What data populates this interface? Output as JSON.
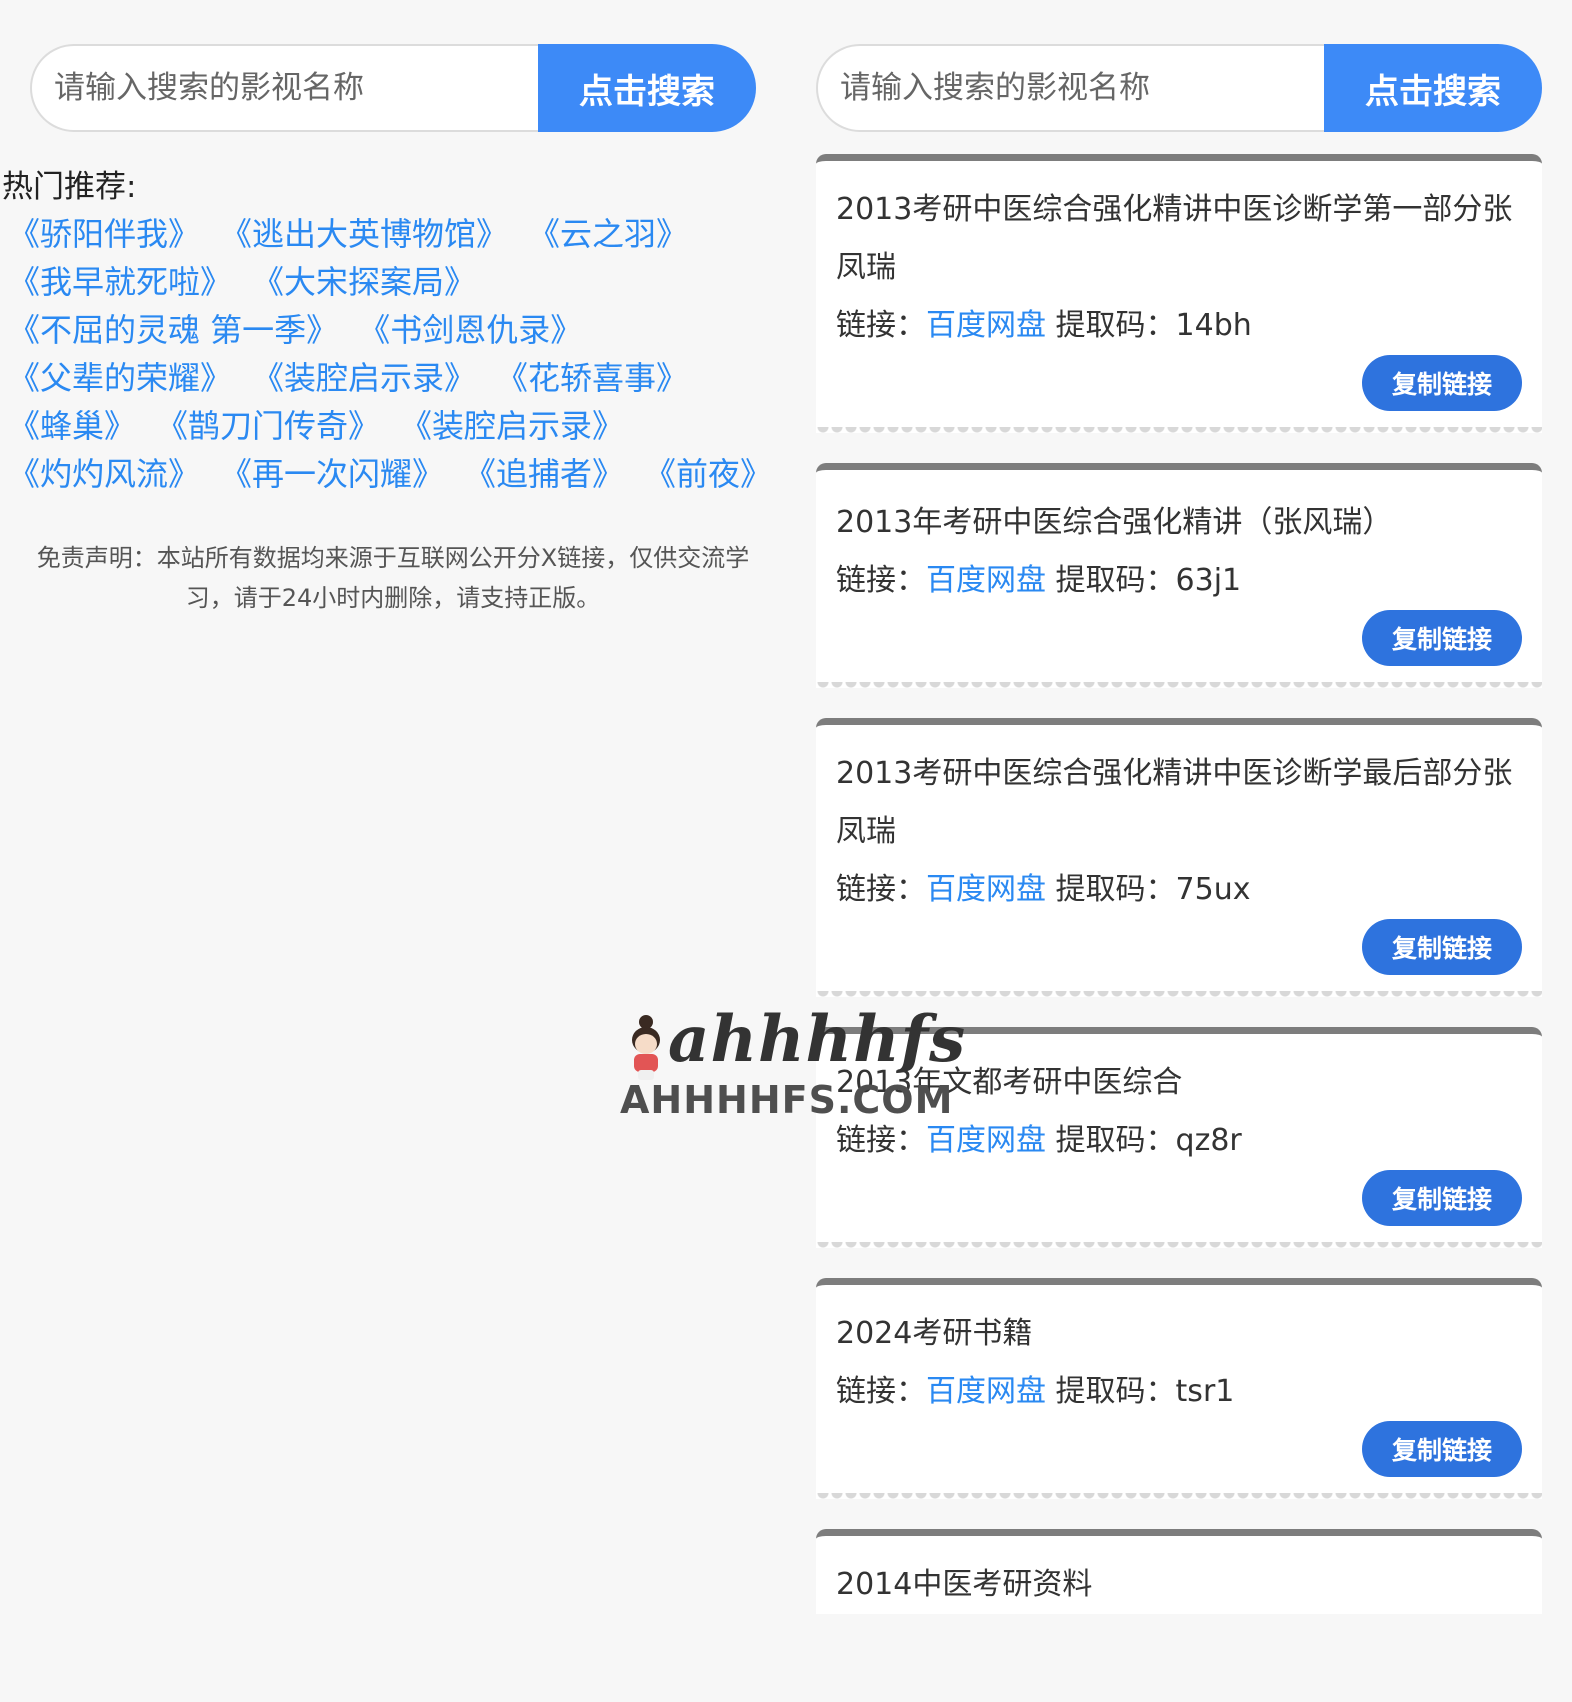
{
  "search": {
    "placeholder": "请输入搜索的影视名称",
    "button_label": "点击搜索"
  },
  "hot": {
    "title": "热门推荐:",
    "rows": [
      [
        "《骄阳伴我》",
        "《逃出大英博物馆》",
        "《云之羽》"
      ],
      [
        "《我早就死啦》",
        "《大宋探案局》"
      ],
      [
        "《不屈的灵魂 第一季》",
        "《书剑恩仇录》"
      ],
      [
        "《父辈的荣耀》",
        "《装腔启示录》",
        "《花轿喜事》"
      ],
      [
        "《蜂巢》",
        "《鹊刀门传奇》",
        "《装腔启示录》"
      ],
      [
        "《灼灼风流》",
        "《再一次闪耀》",
        "《追捕者》",
        "《前夜》"
      ]
    ]
  },
  "disclaimer": "免责声明：本站所有数据均来源于互联网公开分X链接，仅供交流学习，请于24小时内删除，请支持正版。",
  "result_labels": {
    "link_prefix": "链接：",
    "link_text": "百度网盘",
    "code_prefix": "提取码：",
    "copy_label": "复制链接"
  },
  "results": [
    {
      "title": "2013考研中医综合强化精讲中医诊断学第一部分张凤瑞",
      "code": "14bh"
    },
    {
      "title": "2013年考研中医综合强化精讲（张风瑞）",
      "code": "63j1"
    },
    {
      "title": "2013考研中医综合强化精讲中医诊断学最后部分张凤瑞",
      "code": "75ux"
    },
    {
      "title": "2013年文都考研中医综合",
      "code": "qz8r"
    },
    {
      "title": "2024考研书籍",
      "code": "tsr1"
    },
    {
      "title": "2014中医考研资料",
      "code": ""
    }
  ],
  "watermark": {
    "script_text": "ahhhhfs",
    "site_text": "AHHHHFS.COM"
  },
  "colors": {
    "accent": "#3d8af7",
    "link": "#2a89f2",
    "copy_button": "#2e73de"
  }
}
